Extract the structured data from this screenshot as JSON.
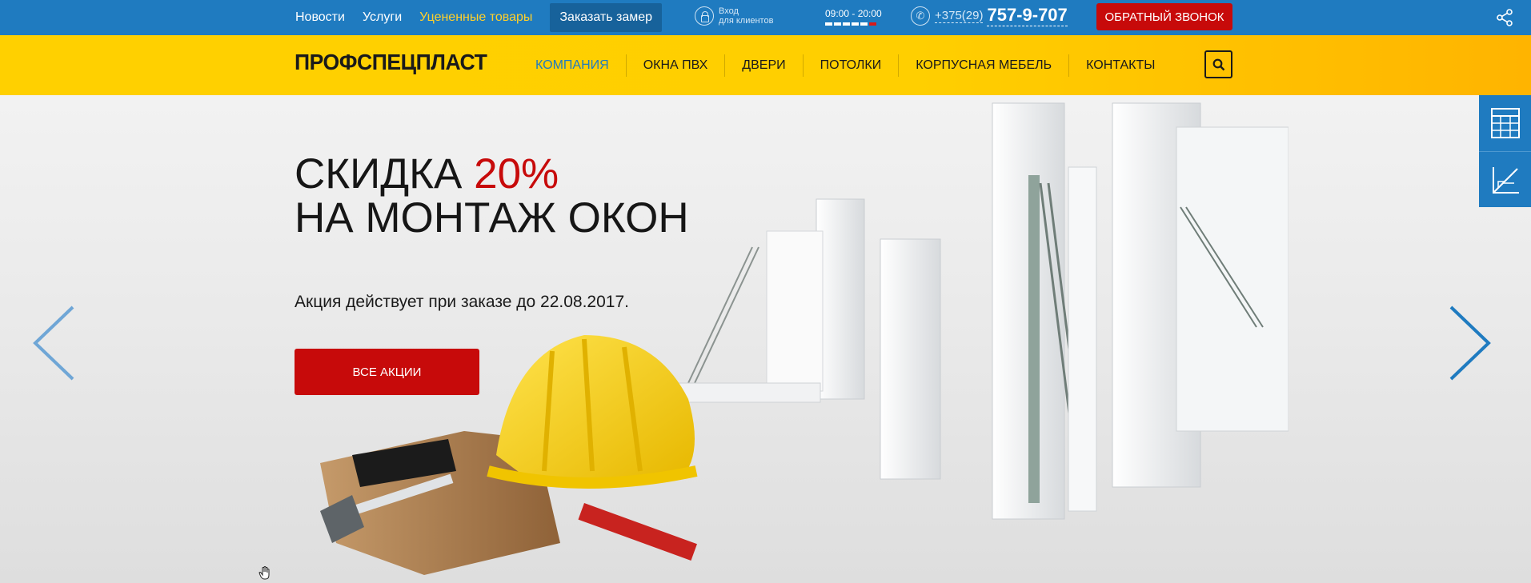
{
  "topbar": {
    "links": [
      {
        "label": "Новости"
      },
      {
        "label": "Услуги"
      },
      {
        "label": "Уцененные товары"
      },
      {
        "label": "Заказать замер"
      }
    ],
    "login": {
      "line1": "Вход",
      "line2": "для клиентов"
    },
    "hours": "09:00 - 20:00",
    "phone": {
      "prefix": "+375(29)",
      "number": "757-9-707"
    },
    "callback_label": "ОБРАТНЫЙ ЗВОНОК",
    "share_icon": "share-icon"
  },
  "header": {
    "logo": "ПРОФСПЕЦПЛАСТ",
    "nav": [
      {
        "label": "КОМПАНИЯ"
      },
      {
        "label": "ОКНА ПВХ"
      },
      {
        "label": "ДВЕРИ"
      },
      {
        "label": "ПОТОЛКИ"
      },
      {
        "label": "КОРПУСНАЯ МЕБЕЛЬ"
      },
      {
        "label": "КОНТАКТЫ"
      }
    ],
    "search_icon": "search-icon"
  },
  "hero": {
    "title_prefix": "СКИДКА",
    "title_accent": "20%",
    "title_line2": "НА МОНТАЖ ОКОН",
    "subtitle": "Акция действует при заказе до 22.08.2017.",
    "button_label": "ВСЕ АКЦИИ"
  },
  "colors": {
    "topbar": "#1f7bc0",
    "header": "#ffcf00",
    "accent_red": "#c70a0a",
    "active_nav": "#1f7bc0"
  },
  "side_tools": [
    "calculator-icon",
    "measure-icon"
  ]
}
